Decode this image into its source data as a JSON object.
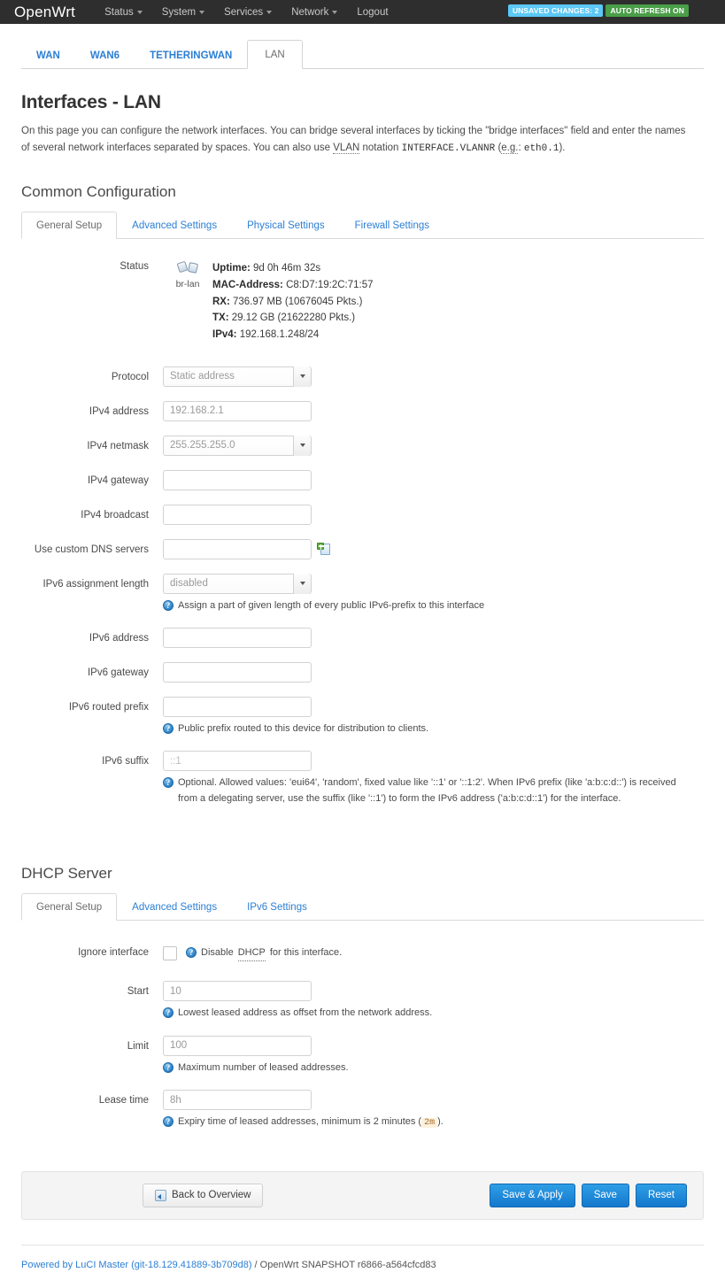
{
  "topbar": {
    "brand": "OpenWrt",
    "nav": [
      {
        "label": "Status",
        "has_caret": true
      },
      {
        "label": "System",
        "has_caret": true
      },
      {
        "label": "Services",
        "has_caret": true
      },
      {
        "label": "Network",
        "has_caret": true
      },
      {
        "label": "Logout",
        "has_caret": false
      }
    ],
    "badges": {
      "unsaved_changes": "UNSAVED CHANGES: 2",
      "auto_refresh": "AUTO REFRESH ON",
      "unsaved_color": "#5bc8f5",
      "refresh_color": "#4a9e48"
    }
  },
  "interface_tabs": [
    {
      "label": "WAN",
      "active": false
    },
    {
      "label": "WAN6",
      "active": false
    },
    {
      "label": "TETHERINGWAN",
      "active": false
    },
    {
      "label": "LAN",
      "active": true
    }
  ],
  "page": {
    "title": "Interfaces - LAN",
    "desc_part1": "On this page you can configure the network interfaces. You can bridge several interfaces by ticking the \"bridge interfaces\" field and enter the names of several network interfaces separated by spaces. You can also use ",
    "desc_vlan": "VLAN",
    "desc_part2": " notation ",
    "desc_code1": "INTERFACE.VLANNR",
    "desc_part3": " (",
    "desc_eg": "e.g.",
    "desc_part4": ": ",
    "desc_code2": "eth0.1",
    "desc_part5": ")."
  },
  "common_config": {
    "title": "Common Configuration",
    "tabs": [
      {
        "label": "General Setup",
        "active": true
      },
      {
        "label": "Advanced Settings",
        "active": false
      },
      {
        "label": "Physical Settings",
        "active": false
      },
      {
        "label": "Firewall Settings",
        "active": false
      }
    ],
    "status": {
      "label": "Status",
      "device": "br-lan",
      "uptime_key": "Uptime:",
      "uptime_value": " 9d 0h 46m 32s",
      "mac_key": "MAC-Address:",
      "mac_value": " C8:D7:19:2C:71:57",
      "rx_key": "RX:",
      "rx_value": " 736.97 MB (10676045 Pkts.)",
      "tx_key": "TX:",
      "tx_value": " 29.12 GB (21622280 Pkts.)",
      "ipv4_key": "IPv4:",
      "ipv4_value": " 192.168.1.248/24"
    },
    "fields": {
      "protocol_label": "Protocol",
      "protocol_value": "Static address",
      "ipv4_address_label": "IPv4 address",
      "ipv4_address_value": "192.168.2.1",
      "ipv4_netmask_label": "IPv4 netmask",
      "ipv4_netmask_value": "255.255.255.0",
      "ipv4_gateway_label": "IPv4 gateway",
      "ipv4_gateway_value": "",
      "ipv4_broadcast_label": "IPv4 broadcast",
      "ipv4_broadcast_value": "",
      "dns_label": "Use custom DNS servers",
      "dns_value": "",
      "ipv6_assign_label": "IPv6 assignment length",
      "ipv6_assign_value": "disabled",
      "ipv6_assign_help": "Assign a part of given length of every public IPv6-prefix to this interface",
      "ipv6_address_label": "IPv6 address",
      "ipv6_address_value": "",
      "ipv6_gateway_label": "IPv6 gateway",
      "ipv6_gateway_value": "",
      "ipv6_routed_prefix_label": "IPv6 routed prefix",
      "ipv6_routed_prefix_value": "",
      "ipv6_routed_prefix_help": "Public prefix routed to this device for distribution to clients.",
      "ipv6_suffix_label": "IPv6 suffix",
      "ipv6_suffix_placeholder": "::1",
      "ipv6_suffix_help": "Optional. Allowed values: 'eui64', 'random', fixed value like '::1' or '::1:2'. When IPv6 prefix (like 'a:b:c:d::') is received from a delegating server, use the suffix (like '::1') to form the IPv6 address ('a:b:c:d::1') for the interface."
    }
  },
  "dhcp_server": {
    "title": "DHCP Server",
    "tabs": [
      {
        "label": "General Setup",
        "active": true
      },
      {
        "label": "Advanced Settings",
        "active": false
      },
      {
        "label": "IPv6 Settings",
        "active": false
      }
    ],
    "ignore_label": "Ignore interface",
    "ignore_checked": false,
    "ignore_help_pre": "Disable ",
    "ignore_help_abbr": "DHCP",
    "ignore_help_post": " for this interface.",
    "start_label": "Start",
    "start_value": "10",
    "start_help": "Lowest leased address as offset from the network address.",
    "limit_label": "Limit",
    "limit_value": "100",
    "limit_help": "Maximum number of leased addresses.",
    "lease_label": "Lease time",
    "lease_value": "8h",
    "lease_help_pre": "Expiry time of leased addresses, minimum is 2 minutes (",
    "lease_help_code": "2m",
    "lease_help_post": ")."
  },
  "actions": {
    "back_label": "Back to Overview",
    "save_apply_label": "Save & Apply",
    "save_label": "Save",
    "reset_label": "Reset"
  },
  "footer": {
    "luci_link": "Powered by LuCI Master (git-18.129.41889-3b709d8)",
    "separator": " / OpenWrt SNAPSHOT r6866-a564cfcd83"
  }
}
